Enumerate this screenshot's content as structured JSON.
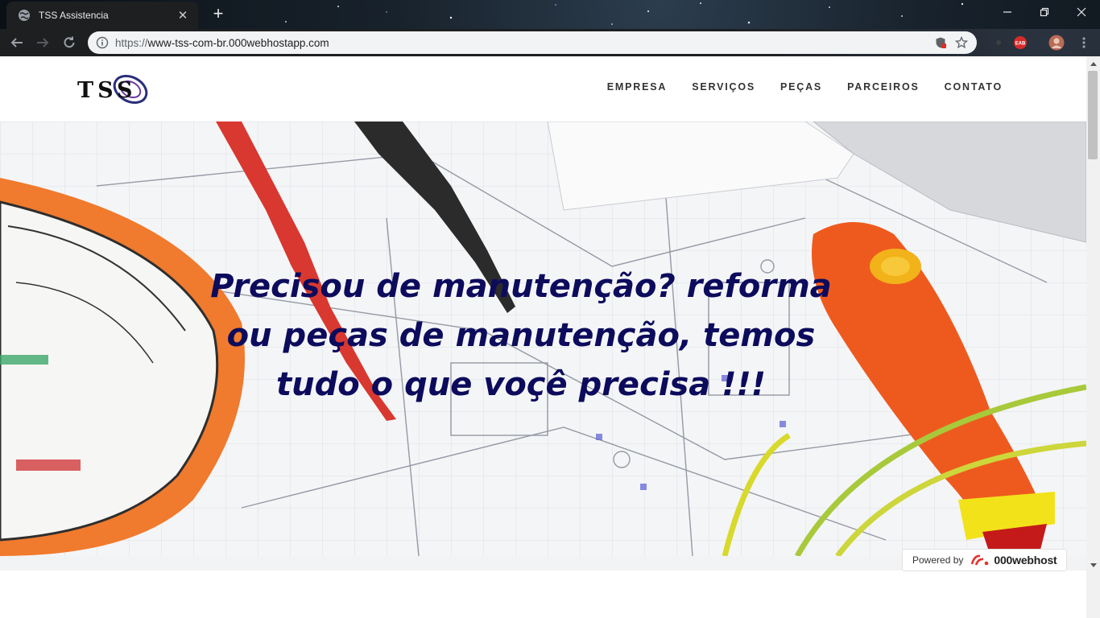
{
  "browser": {
    "tab_title": "TSS Assistencia",
    "tab_close": "✕",
    "new_tab": "+",
    "url_scheme": "https://",
    "url_host": "www-tss-com-br.000webhostapp.com",
    "icons": [
      "globe-icon",
      "back-icon",
      "forward-icon",
      "reload-icon",
      "info-icon",
      "shield-icon",
      "star-icon",
      "extension-icon",
      "adblock-icon",
      "profile-avatar",
      "menu-dots-icon",
      "minimize-icon",
      "restore-icon",
      "close-window-icon"
    ]
  },
  "site": {
    "logo_text": "TSS",
    "nav": [
      "EMPRESA",
      "SERVIÇOS",
      "PEÇAS",
      "PARCEIROS",
      "CONTATO"
    ],
    "hero_headline": "Precisou de manutenção? reforma ou peças de manutenção, temos tudo o que voçê precisa !!!",
    "headline_color": "#0c0b5c"
  },
  "footer_badge": {
    "label": "Powered by",
    "brand": "000webhost",
    "brand_color": "#e5322d"
  },
  "colors": {
    "chrome_dark": "#1e1f21",
    "omnibox": "#f1f3f4"
  }
}
